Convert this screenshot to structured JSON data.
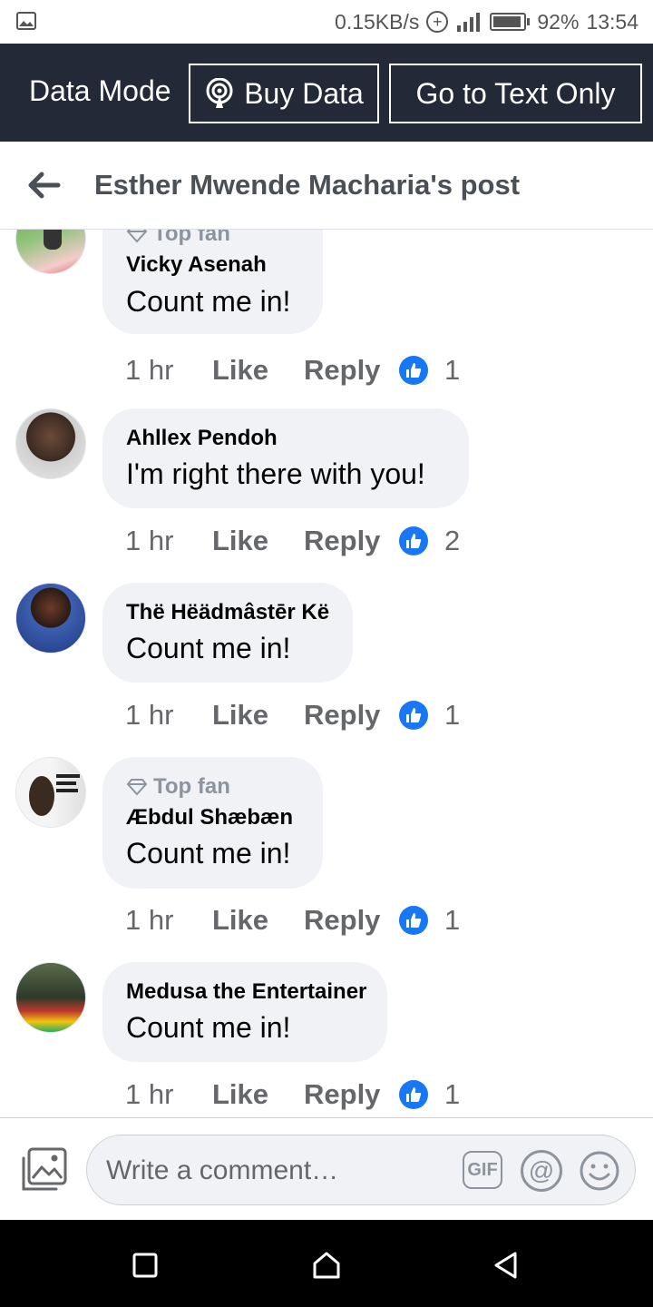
{
  "status_bar": {
    "network_speed": "0.15KB/s",
    "battery_percent": "92%",
    "time": "13:54",
    "battery_level": 0.92,
    "icons": [
      "image-icon",
      "data-saver-icon",
      "signal-icon",
      "battery-icon"
    ]
  },
  "data_bar": {
    "label": "Data Mode",
    "buy_data_label": "Buy Data",
    "text_only_label": "Go to Text Only",
    "background": "#232936"
  },
  "header": {
    "title": "Esther Mwende Macharia's post",
    "back_icon": "back-arrow-icon"
  },
  "comments": [
    {
      "badge": "Top fan",
      "author": "Vicky Asenah",
      "text": "Count me in!",
      "time": "1 hr",
      "like": "Like",
      "reply": "Reply",
      "reactions": "1"
    },
    {
      "badge": "",
      "author": "Ahllex Pendoh",
      "text": "I'm right there with you!",
      "time": "1 hr",
      "like": "Like",
      "reply": "Reply",
      "reactions": "2"
    },
    {
      "badge": "",
      "author": "Thë Hëädmâstēr Kë",
      "text": "Count me in!",
      "time": "1 hr",
      "like": "Like",
      "reply": "Reply",
      "reactions": "1"
    },
    {
      "badge": "Top fan",
      "author": "Æbdul Shæbæn",
      "text": "Count me in!",
      "time": "1 hr",
      "like": "Like",
      "reply": "Reply",
      "reactions": "1"
    },
    {
      "badge": "",
      "author": "Medusa the Entertainer",
      "text": "Count me in!",
      "time": "1 hr",
      "like": "Like",
      "reply": "Reply",
      "reactions": "1"
    }
  ],
  "composer": {
    "placeholder": "Write a comment…",
    "gif_label": "GIF",
    "at_label": "@"
  },
  "colors": {
    "accent": "#1877f2",
    "bubble": "#f0f2f5",
    "secondary_text": "#65676b"
  }
}
